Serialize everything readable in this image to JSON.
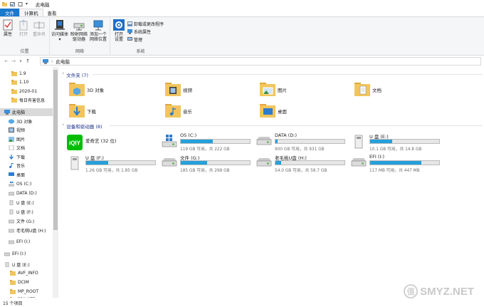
{
  "window": {
    "title": "此电脑"
  },
  "tabs": {
    "file": "文件",
    "computer": "计算机",
    "view": "查看"
  },
  "ribbon": {
    "location": {
      "label": "位置",
      "properties": "属性",
      "open": "打开",
      "rename": "重命名"
    },
    "network": {
      "label": "网络",
      "access_media": "访问媒体",
      "map_drive_1": "映射网络",
      "map_drive_2": "驱动器",
      "add_location_1": "添加一个",
      "add_location_2": "网络位置"
    },
    "system": {
      "label": "系统",
      "open_settings_1": "打开",
      "open_settings_2": "设置",
      "uninstall": "卸载或更改程序",
      "system_properties": "系统属性",
      "manage": "管理"
    }
  },
  "address": {
    "path": "此电脑"
  },
  "nav": {
    "items": [
      {
        "label": "1.9",
        "icon": "folder-icon"
      },
      {
        "label": "1.10",
        "icon": "folder-icon"
      },
      {
        "label": "2020-01",
        "icon": "folder-icon"
      },
      {
        "label": "每日有害信息",
        "icon": "folder-icon"
      },
      {
        "label": "此电脑",
        "icon": "computer-icon"
      },
      {
        "label": "3D 对象",
        "icon": "3d-objects-icon"
      },
      {
        "label": "视频",
        "icon": "video-icon"
      },
      {
        "label": "图片",
        "icon": "pictures-icon"
      },
      {
        "label": "文档",
        "icon": "documents-icon"
      },
      {
        "label": "下载",
        "icon": "download-icon"
      },
      {
        "label": "音乐",
        "icon": "music-icon"
      },
      {
        "label": "桌面",
        "icon": "desktop-icon"
      },
      {
        "label": "OS (C:)",
        "icon": "windows-drive-icon"
      },
      {
        "label": "DATA (D:)",
        "icon": "drive-icon"
      },
      {
        "label": "U 盘 (E:)",
        "icon": "usb-drive-icon"
      },
      {
        "label": "U 盘 (F:)",
        "icon": "usb-drive-icon"
      },
      {
        "label": "文件 (G:)",
        "icon": "drive-icon"
      },
      {
        "label": "老毛桃U盘 (H:)",
        "icon": "drive-icon"
      },
      {
        "label": "EFI (I:)",
        "icon": "drive-icon"
      },
      {
        "label": "EFI (I:)",
        "icon": "drive-icon"
      },
      {
        "label": "U 盘 (E:)",
        "icon": "usb-drive-icon"
      },
      {
        "label": "AVF_INFO",
        "icon": "folder-icon"
      },
      {
        "label": "DCIM",
        "icon": "folder-icon"
      },
      {
        "label": "MP_ROOT",
        "icon": "folder-icon"
      },
      {
        "label": "PRIVATE",
        "icon": "folder-icon"
      }
    ]
  },
  "folders_section": {
    "label": "文件夹 (7)"
  },
  "folders": [
    {
      "label": "3D 对象",
      "icon": "3d-objects-folder-icon"
    },
    {
      "label": "视频",
      "icon": "video-folder-icon"
    },
    {
      "label": "图片",
      "icon": "pictures-folder-icon"
    },
    {
      "label": "文档",
      "icon": "documents-folder-icon"
    },
    {
      "label": "下载",
      "icon": "download-folder-icon"
    },
    {
      "label": "音乐",
      "icon": "music-folder-icon"
    },
    {
      "label": "桌面",
      "icon": "desktop-folder-icon"
    }
  ],
  "drives_section": {
    "label": "设备和驱动器 (8)"
  },
  "drives": [
    {
      "name": "爱奇艺 (32 位)",
      "icon": "iqiyi-app-icon",
      "free_text": "",
      "used_fraction": null
    },
    {
      "name": "OS (C:)",
      "icon": "windows-drive-icon",
      "free_text": "119 GB 可用，共 222 GB",
      "used_fraction": 0.46
    },
    {
      "name": "DATA (D:)",
      "icon": "hdd-icon",
      "free_text": "900 GB 可用，共 931 GB",
      "used_fraction": 0.03
    },
    {
      "name": "U 盘 (E:)",
      "icon": "usb-drive-icon",
      "free_text": "10.1 GB 可用，共 14.8 GB",
      "used_fraction": 0.32
    },
    {
      "name": "U 盘 (F:)",
      "icon": "usb-drive-icon",
      "free_text": "1.26 GB 可用，共 1.85 GB",
      "used_fraction": 0.32
    },
    {
      "name": "文件 (G:)",
      "icon": "hdd-icon",
      "free_text": "185 GB 可用，共 298 GB",
      "used_fraction": 0.38
    },
    {
      "name": "老毛桃U盘 (H:)",
      "icon": "hdd-icon",
      "free_text": "54.0 GB 可用，共 58.7 GB",
      "used_fraction": 0.08
    },
    {
      "name": "EFI (I:)",
      "icon": "hdd-icon",
      "free_text": "117 MB 可用，共 447 MB",
      "used_fraction": 0.74
    }
  ],
  "status": {
    "count": "15 个项目"
  },
  "watermark": {
    "badge": "值",
    "text": "SMYZ.NET"
  },
  "colors": {
    "accent": "#1979ca",
    "bar_fill": "#26a0da",
    "folder": "#f2c55c",
    "section_header": "#1e3287"
  }
}
